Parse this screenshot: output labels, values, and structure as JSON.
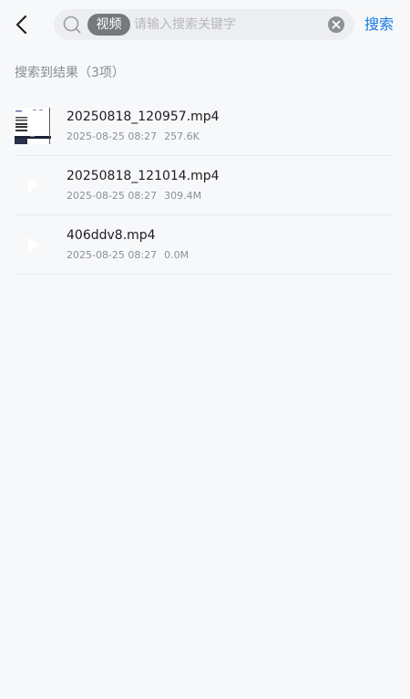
{
  "header": {
    "back_icon": "chevron-left-icon",
    "search_icon": "search-icon",
    "filter_tag": "视频",
    "search_placeholder": "请输入搜索关键字",
    "clear_icon": "clear-circle-icon",
    "search_button_label": "搜索",
    "accent_color": "#1677e6"
  },
  "results": {
    "summary": "搜索到结果（3项）",
    "items": [
      {
        "name": "20250818_120957.mp4",
        "date": "2025-08-25 08:27",
        "size": "257.6K",
        "thumb": "video-screenshot-thumbnail"
      },
      {
        "name": "20250818_121014.mp4",
        "date": "2025-08-25 08:27",
        "size": "309.4M",
        "thumb": "play-icon"
      },
      {
        "name": "406ddv8.mp4",
        "date": "2025-08-25 08:27",
        "size": "0.0M",
        "thumb": "play-icon"
      }
    ]
  }
}
